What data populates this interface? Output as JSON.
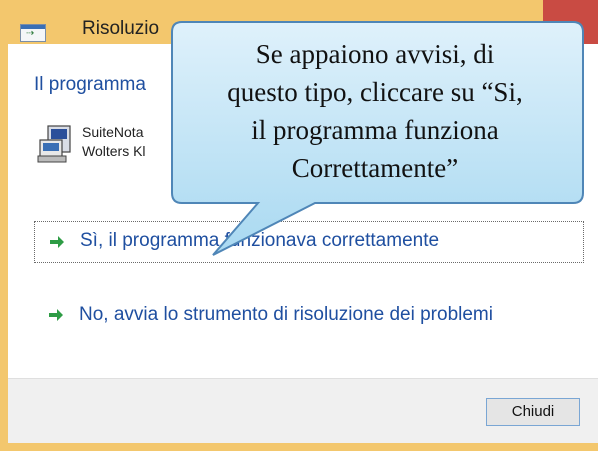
{
  "window": {
    "title": "Risoluzio",
    "heading": "Il programma",
    "program_name_line1": "SuiteNota",
    "program_name_line2": "Wolters Kl",
    "colors": {
      "accent": "#1f4fa0",
      "frame": "#f3c76d",
      "close": "#c94b43",
      "arrow": "#2e9c45"
    }
  },
  "options": [
    {
      "label": "Sì, il programma funzionava correttamente",
      "icon": "green-arrow-icon"
    },
    {
      "label": "No, avvia lo strumento di risoluzione dei problemi",
      "icon": "green-arrow-icon"
    }
  ],
  "footer": {
    "close_label": "Chiudi"
  },
  "callout": {
    "lines": [
      "Se appaiono avvisi, di",
      "questo tipo, cliccare su “Si,",
      "il programma funziona",
      "Correttamente”"
    ]
  }
}
